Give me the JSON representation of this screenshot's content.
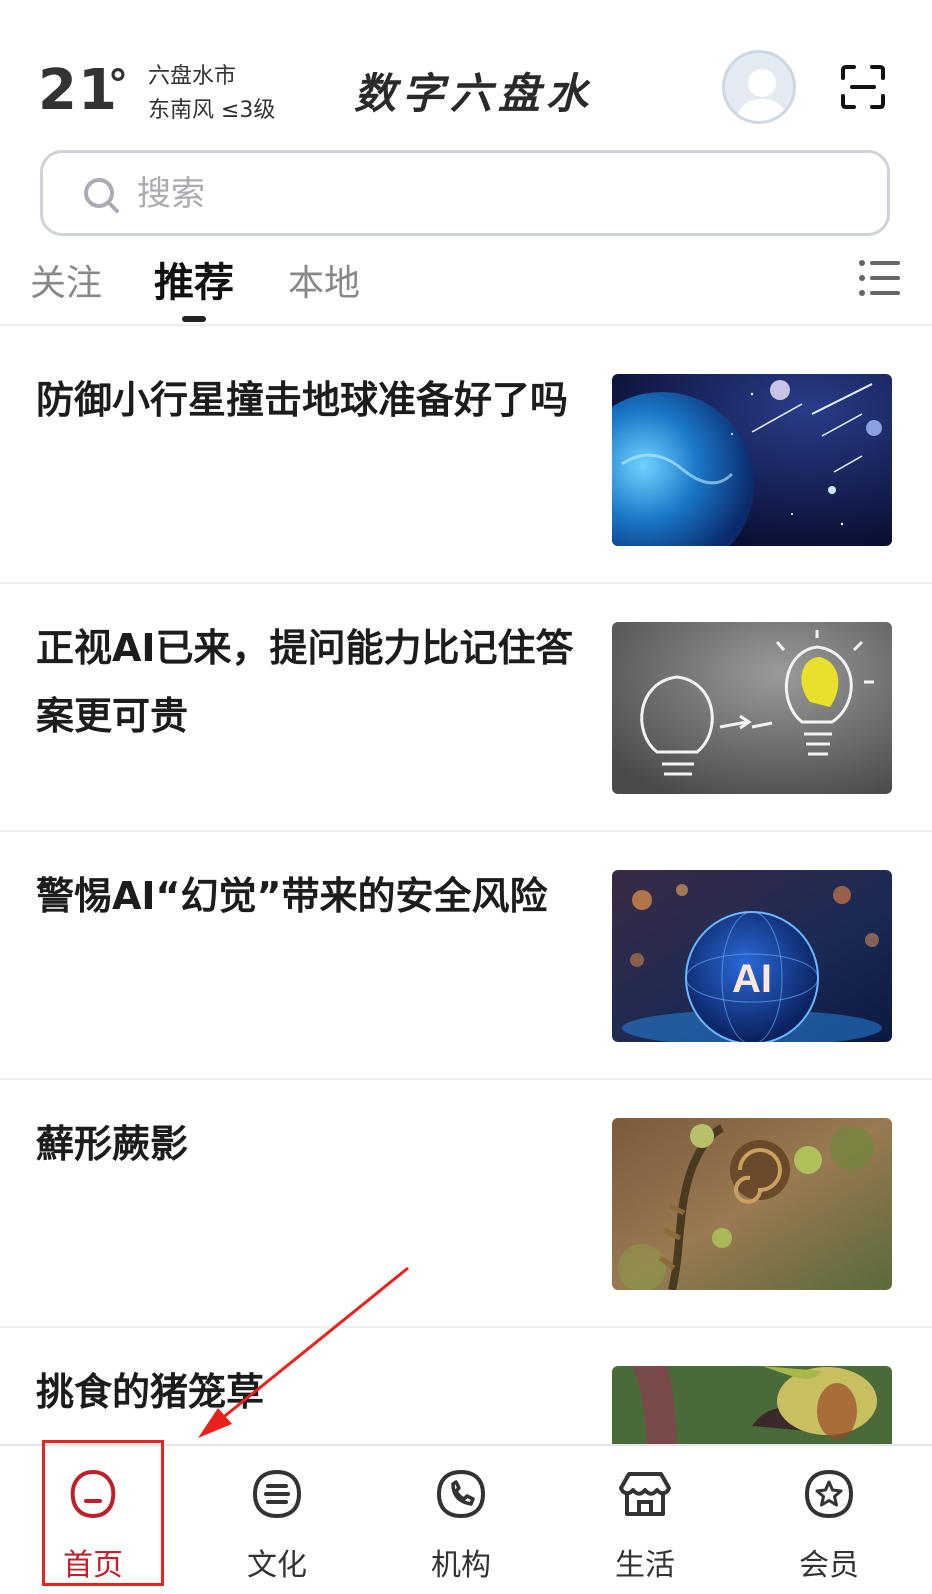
{
  "weather": {
    "temperature": "21",
    "degree_symbol": "°",
    "city": "六盘水市",
    "wind": "东南风 ≤3级"
  },
  "brand": {
    "title": "数字六盘水"
  },
  "search": {
    "placeholder": "搜索"
  },
  "tabs": [
    {
      "label": "关注",
      "active": false
    },
    {
      "label": "推荐",
      "active": true
    },
    {
      "label": "本地",
      "active": false
    }
  ],
  "feed": [
    {
      "title": "防御小行星撞击地球准备好了吗",
      "image": "planet-space-image"
    },
    {
      "title": "正视AI已来，提问能力比记住答案更可贵",
      "image": "lightbulb-chalk-image"
    },
    {
      "title": "警惕AI“幻觉”带来的安全风险",
      "image": "ai-sphere-image"
    },
    {
      "title": "蘚形蕨影",
      "image": "fern-fiddlehead-image"
    },
    {
      "title": "挑食的猪笼草",
      "image": "pitcher-plant-image"
    }
  ],
  "tabbar": [
    {
      "label": "首页",
      "icon": "home-icon",
      "active": true
    },
    {
      "label": "文化",
      "icon": "culture-icon",
      "active": false
    },
    {
      "label": "机构",
      "icon": "phone-icon",
      "active": false
    },
    {
      "label": "生活",
      "icon": "shop-icon",
      "active": false
    },
    {
      "label": "会员",
      "icon": "member-star-icon",
      "active": false
    }
  ],
  "colors": {
    "accent_red": "#c0202a",
    "annotation_red": "#e8231e",
    "text_dark": "#1c1c1c",
    "tab_inactive": "#888888"
  }
}
